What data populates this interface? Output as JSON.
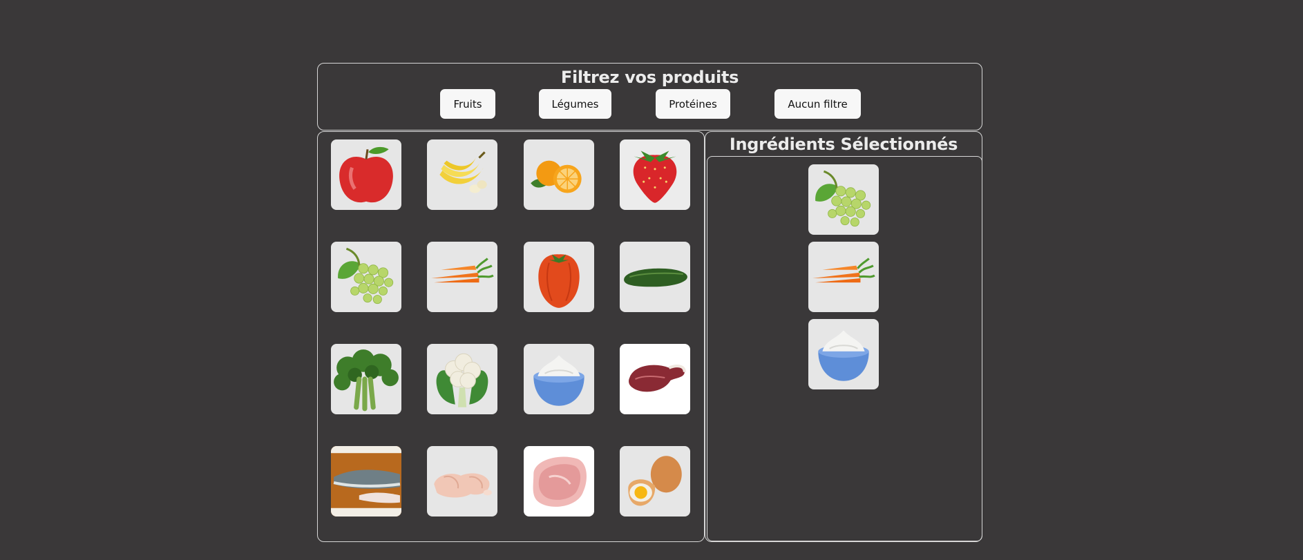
{
  "filter": {
    "title": "Filtrez vos produits",
    "buttons": [
      "Fruits",
      "Légumes",
      "Protéines",
      "Aucun filtre"
    ]
  },
  "products": [
    {
      "icon": "apple-icon"
    },
    {
      "icon": "banana-icon"
    },
    {
      "icon": "orange-icon"
    },
    {
      "icon": "strawberry-icon"
    },
    {
      "icon": "grapes-icon"
    },
    {
      "icon": "carrot-icon"
    },
    {
      "icon": "tomato-icon"
    },
    {
      "icon": "cucumber-icon"
    },
    {
      "icon": "broccoli-icon"
    },
    {
      "icon": "cauliflower-icon"
    },
    {
      "icon": "cream-bowl-icon"
    },
    {
      "icon": "steak-icon"
    },
    {
      "icon": "fish-fillet-icon"
    },
    {
      "icon": "chicken-icon"
    },
    {
      "icon": "pork-chop-icon"
    },
    {
      "icon": "eggs-icon"
    }
  ],
  "selected": {
    "title": "Ingrédients Sélectionnés",
    "items": [
      {
        "icon": "grapes-icon"
      },
      {
        "icon": "carrot-icon"
      },
      {
        "icon": "cream-bowl-icon"
      }
    ]
  }
}
